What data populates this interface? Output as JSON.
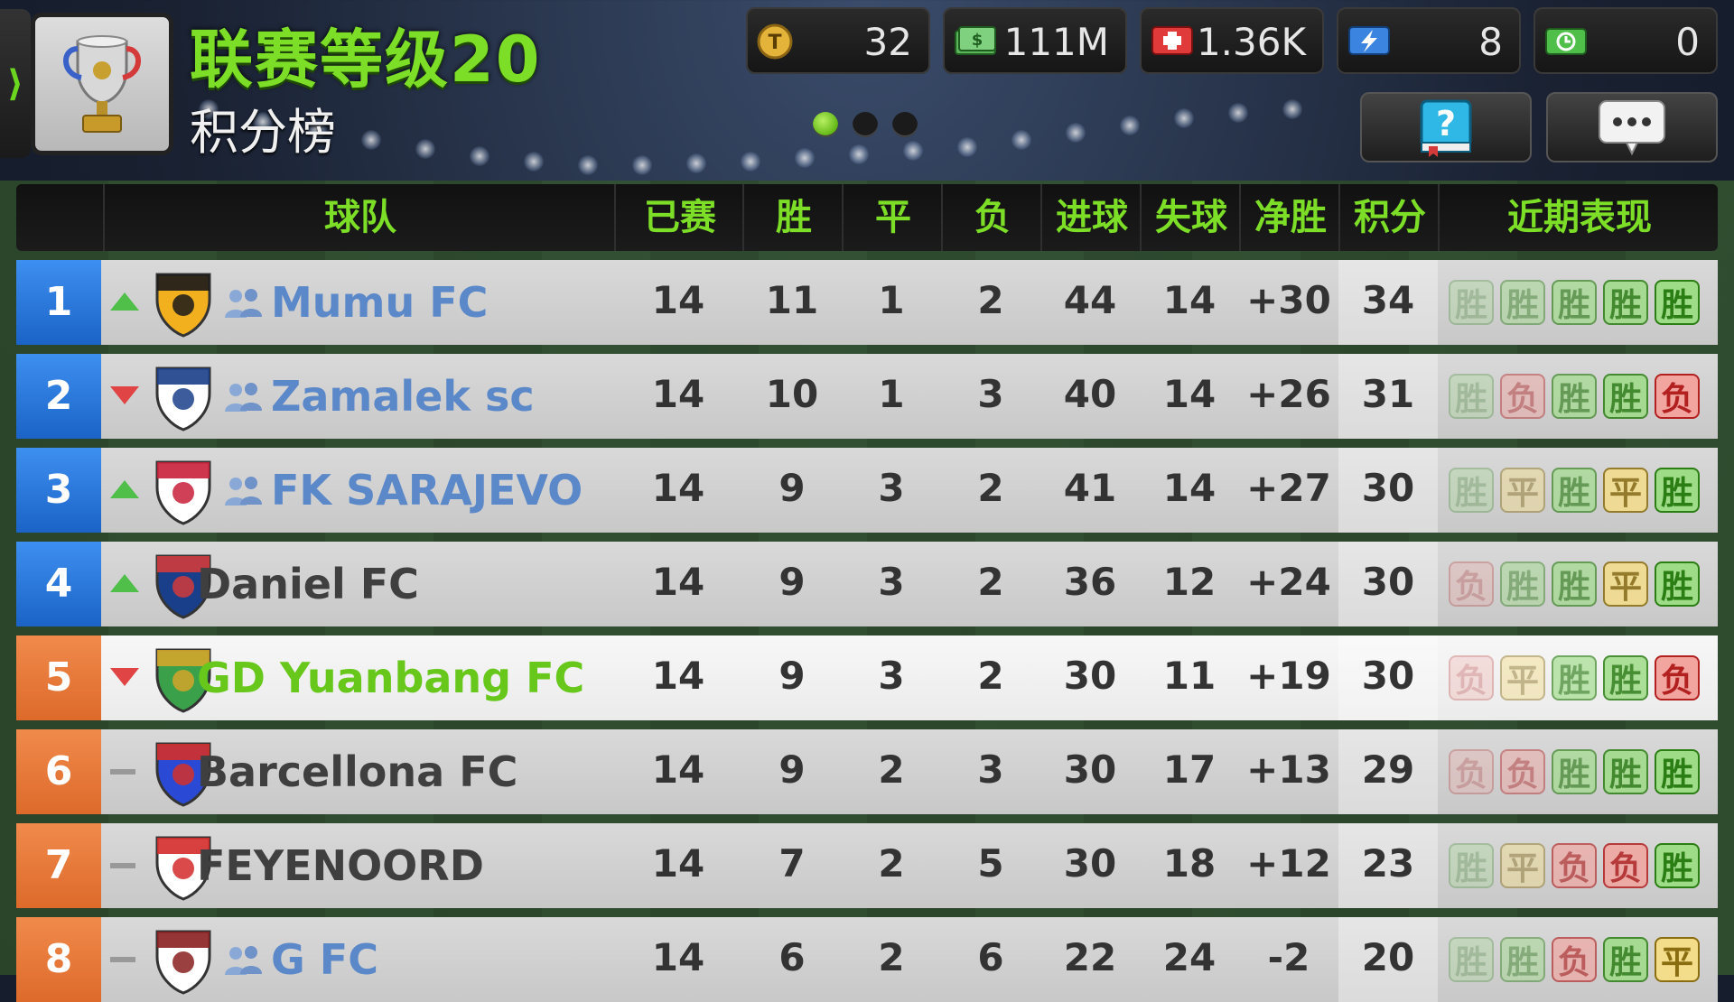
{
  "header": {
    "league_title": "联赛等级20",
    "subtitle": "积分榜",
    "side_arrow": "⟩"
  },
  "resources": [
    {
      "icon": "coin-icon",
      "value": "32"
    },
    {
      "icon": "cash-icon",
      "value": "111M"
    },
    {
      "icon": "medical-icon",
      "value": "1.36K"
    },
    {
      "icon": "energy-icon",
      "value": "8"
    },
    {
      "icon": "timer-icon",
      "value": "0"
    }
  ],
  "pager": {
    "count": 3,
    "active": 0
  },
  "table": {
    "columns": [
      "球队",
      "已赛",
      "胜",
      "平",
      "负",
      "进球",
      "失球",
      "净胜",
      "积分",
      "近期表现"
    ],
    "rows": [
      {
        "rank": "1",
        "trend": "up",
        "team": "Mumu FC",
        "friend": true,
        "played": "14",
        "won": "11",
        "drawn": "1",
        "lost": "2",
        "gf": "44",
        "ga": "14",
        "gd": "+30",
        "pts": "34",
        "form": [
          "胜",
          "胜",
          "胜",
          "胜",
          "胜"
        ]
      },
      {
        "rank": "2",
        "trend": "down",
        "team": "Zamalek sc",
        "friend": true,
        "played": "14",
        "won": "10",
        "drawn": "1",
        "lost": "3",
        "gf": "40",
        "ga": "14",
        "gd": "+26",
        "pts": "31",
        "form": [
          "胜",
          "负",
          "胜",
          "胜",
          "负"
        ]
      },
      {
        "rank": "3",
        "trend": "up",
        "team": "FK SARAJEVO",
        "friend": true,
        "played": "14",
        "won": "9",
        "drawn": "3",
        "lost": "2",
        "gf": "41",
        "ga": "14",
        "gd": "+27",
        "pts": "30",
        "form": [
          "胜",
          "平",
          "胜",
          "平",
          "胜"
        ]
      },
      {
        "rank": "4",
        "trend": "up",
        "team": "Daniel FC",
        "friend": false,
        "played": "14",
        "won": "9",
        "drawn": "3",
        "lost": "2",
        "gf": "36",
        "ga": "12",
        "gd": "+24",
        "pts": "30",
        "form": [
          "负",
          "胜",
          "胜",
          "平",
          "胜"
        ]
      },
      {
        "rank": "5",
        "trend": "down",
        "team": "GD Yuanbang FC",
        "friend": false,
        "me": true,
        "played": "14",
        "won": "9",
        "drawn": "3",
        "lost": "2",
        "gf": "30",
        "ga": "11",
        "gd": "+19",
        "pts": "30",
        "form": [
          "负",
          "平",
          "胜",
          "胜",
          "负"
        ]
      },
      {
        "rank": "6",
        "trend": "same",
        "team": "Barcellona FC",
        "friend": false,
        "played": "14",
        "won": "9",
        "drawn": "2",
        "lost": "3",
        "gf": "30",
        "ga": "17",
        "gd": "+13",
        "pts": "29",
        "form": [
          "负",
          "负",
          "胜",
          "胜",
          "胜"
        ]
      },
      {
        "rank": "7",
        "trend": "same",
        "team": "FEYENOORD",
        "friend": false,
        "played": "14",
        "won": "7",
        "drawn": "2",
        "lost": "5",
        "gf": "30",
        "ga": "18",
        "gd": "+12",
        "pts": "23",
        "form": [
          "胜",
          "平",
          "负",
          "负",
          "胜"
        ]
      },
      {
        "rank": "8",
        "trend": "same",
        "team": "G FC",
        "friend": true,
        "played": "14",
        "won": "6",
        "drawn": "2",
        "lost": "6",
        "gf": "22",
        "ga": "24",
        "gd": "-2",
        "pts": "20",
        "form": [
          "胜",
          "胜",
          "负",
          "胜",
          "平"
        ]
      }
    ]
  },
  "colors": {
    "accent_green": "#7dde27",
    "rank_top": "#2a7ae0",
    "rank_other": "#e8793a",
    "win": "#2b7e14",
    "loss": "#b22020",
    "draw": "#8a6d10"
  }
}
